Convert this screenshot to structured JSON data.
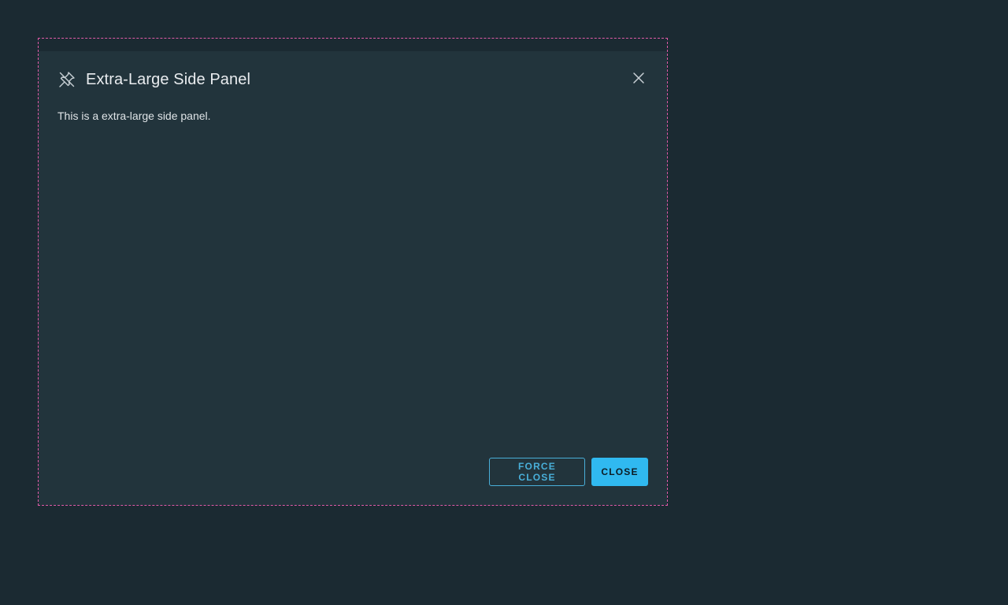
{
  "panel": {
    "title": "Extra-Large Side Panel",
    "body_text": "This is a extra-large side panel.",
    "pin_icon": "pin-icon",
    "close_icon": "close-icon"
  },
  "footer": {
    "force_close_label": "FORCE CLOSE",
    "close_label": "CLOSE"
  },
  "colors": {
    "background": "#1b2a32",
    "panel": "#22343c",
    "accent": "#30b9f0",
    "outline_border": "#e05aa8"
  }
}
